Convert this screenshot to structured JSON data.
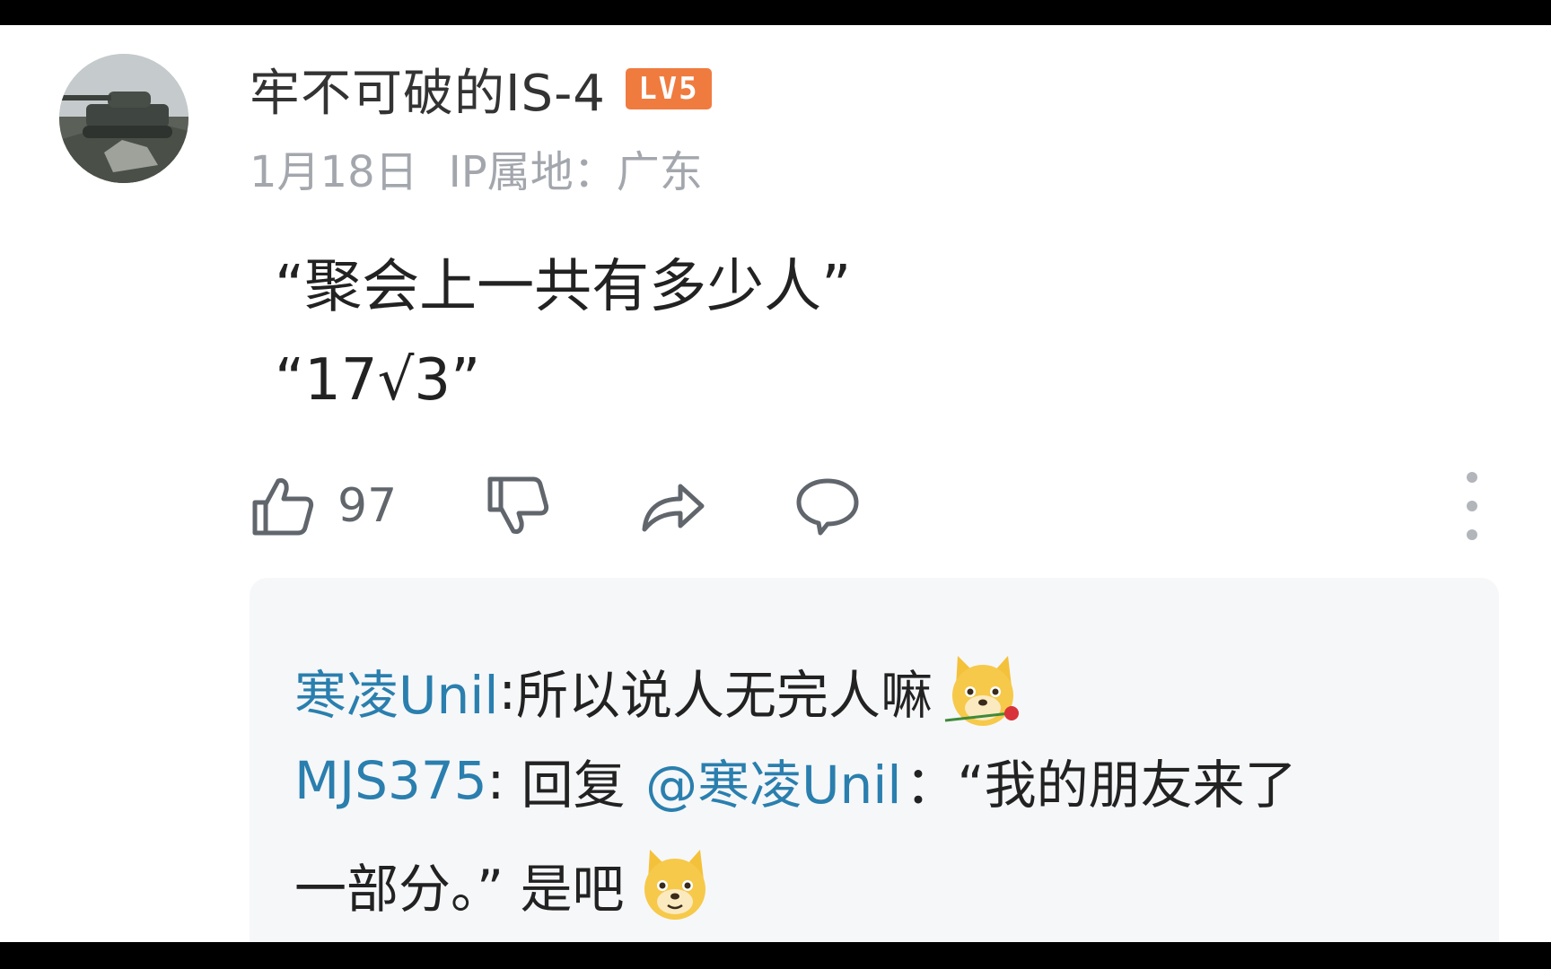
{
  "comment": {
    "username": "牢不可破的IS-4",
    "level_badge": "LV5",
    "date": "1月18日",
    "ip_location": "IP属地：广东",
    "lines": [
      "“聚会上一共有多少人”",
      "“17√3”"
    ],
    "like_count": "97"
  },
  "icons": {
    "like": "thumbs-up-icon",
    "dislike": "thumbs-down-icon",
    "share": "share-icon",
    "reply": "comment-bubble-icon",
    "more": "more-vertical-icon",
    "emoji": "doge-emoji"
  },
  "colors": {
    "username_link": "#2a7fae",
    "level_badge": "#f07b3f",
    "meta_text": "#a3a7ad"
  },
  "replies": [
    {
      "user": "寒凌Unil",
      "separator": ":",
      "text": " 所以说人无完人嘛"
    },
    {
      "user": "MJS375",
      "separator": ":",
      "prefix": " 回复 ",
      "mention": "@寒凌Unil",
      "text_part1": "：“我的朋友来了",
      "text_part2": "一部分。” 是吧"
    }
  ]
}
